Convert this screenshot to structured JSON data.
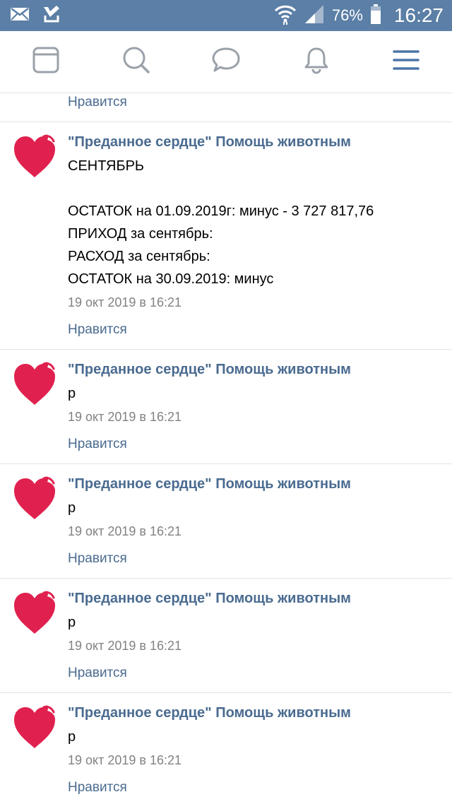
{
  "status_bar": {
    "battery": "76%",
    "time": "16:27",
    "icons": [
      "mail-icon",
      "check-download-icon",
      "wifi-icon",
      "signal-icon",
      "battery-icon"
    ]
  },
  "nav": {
    "icons": [
      "feed-icon",
      "search-icon",
      "messages-icon",
      "notifications-icon",
      "menu-icon"
    ],
    "accent": "#4a76a8"
  },
  "colors": {
    "status_bar_bg": "#5b7fa6",
    "link": "#4a6b90",
    "heart": "#e0214f",
    "meta": "#828282"
  },
  "comments": [
    {
      "author": "\"Преданное сердце\" Помощь животным",
      "text": "р",
      "date": "19 окт 2019 в 16:21",
      "like": "Нравится"
    },
    {
      "author": "\"Преданное сердце\" Помощь животным",
      "text": "СЕНТЯБРЬ\n\nОСТАТОК на 01.09.2019г: минус - 3 727 817,76\nПРИХОД за сентябрь:\nРАСХОД за сентябрь:\nОСТАТОК на 30.09.2019: минус",
      "date": "19 окт 2019 в 16:21",
      "like": "Нравится"
    },
    {
      "author": "\"Преданное сердце\" Помощь животным",
      "text": "р",
      "date": "19 окт 2019 в 16:21",
      "like": "Нравится"
    },
    {
      "author": "\"Преданное сердце\" Помощь животным",
      "text": "р",
      "date": "19 окт 2019 в 16:21",
      "like": "Нравится"
    },
    {
      "author": "\"Преданное сердце\" Помощь животным",
      "text": "р",
      "date": "19 окт 2019 в 16:21",
      "like": "Нравится"
    },
    {
      "author": "\"Преданное сердце\" Помощь животным",
      "text": "р",
      "date": "19 окт 2019 в 16:21",
      "like": "Нравится"
    }
  ]
}
